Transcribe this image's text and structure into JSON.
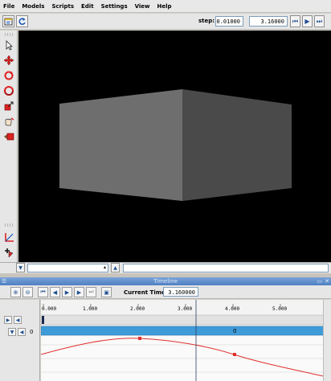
{
  "menu": [
    "File",
    "Models",
    "Scripts",
    "Edit",
    "Settings",
    "View",
    "Help"
  ],
  "toolbar": {
    "step_label": "step:",
    "step_value": "0.01000",
    "time_value": "3.16000"
  },
  "left_tools": [
    "select-arrow-icon",
    "move-cross-icon",
    "rotate-icon",
    "rotate-alt-icon",
    "scale-icon",
    "hand-icon",
    "camera-orbit-icon",
    "axis-icon",
    "add-object-icon"
  ],
  "timeline": {
    "title": "Timeline",
    "current_time_label": "Current Time:",
    "current_time": "3.160000",
    "ruler_ticks": [
      "0.000",
      "1.000",
      "2.000",
      "3.000",
      "4.000",
      "5.000"
    ],
    "track_label": "0",
    "bar_label": "0"
  },
  "colors": {
    "accent": "#4f7fc2",
    "track_bar": "#3f9bd8",
    "curve": "#e0302e",
    "cursor": "#2f3f5f"
  }
}
